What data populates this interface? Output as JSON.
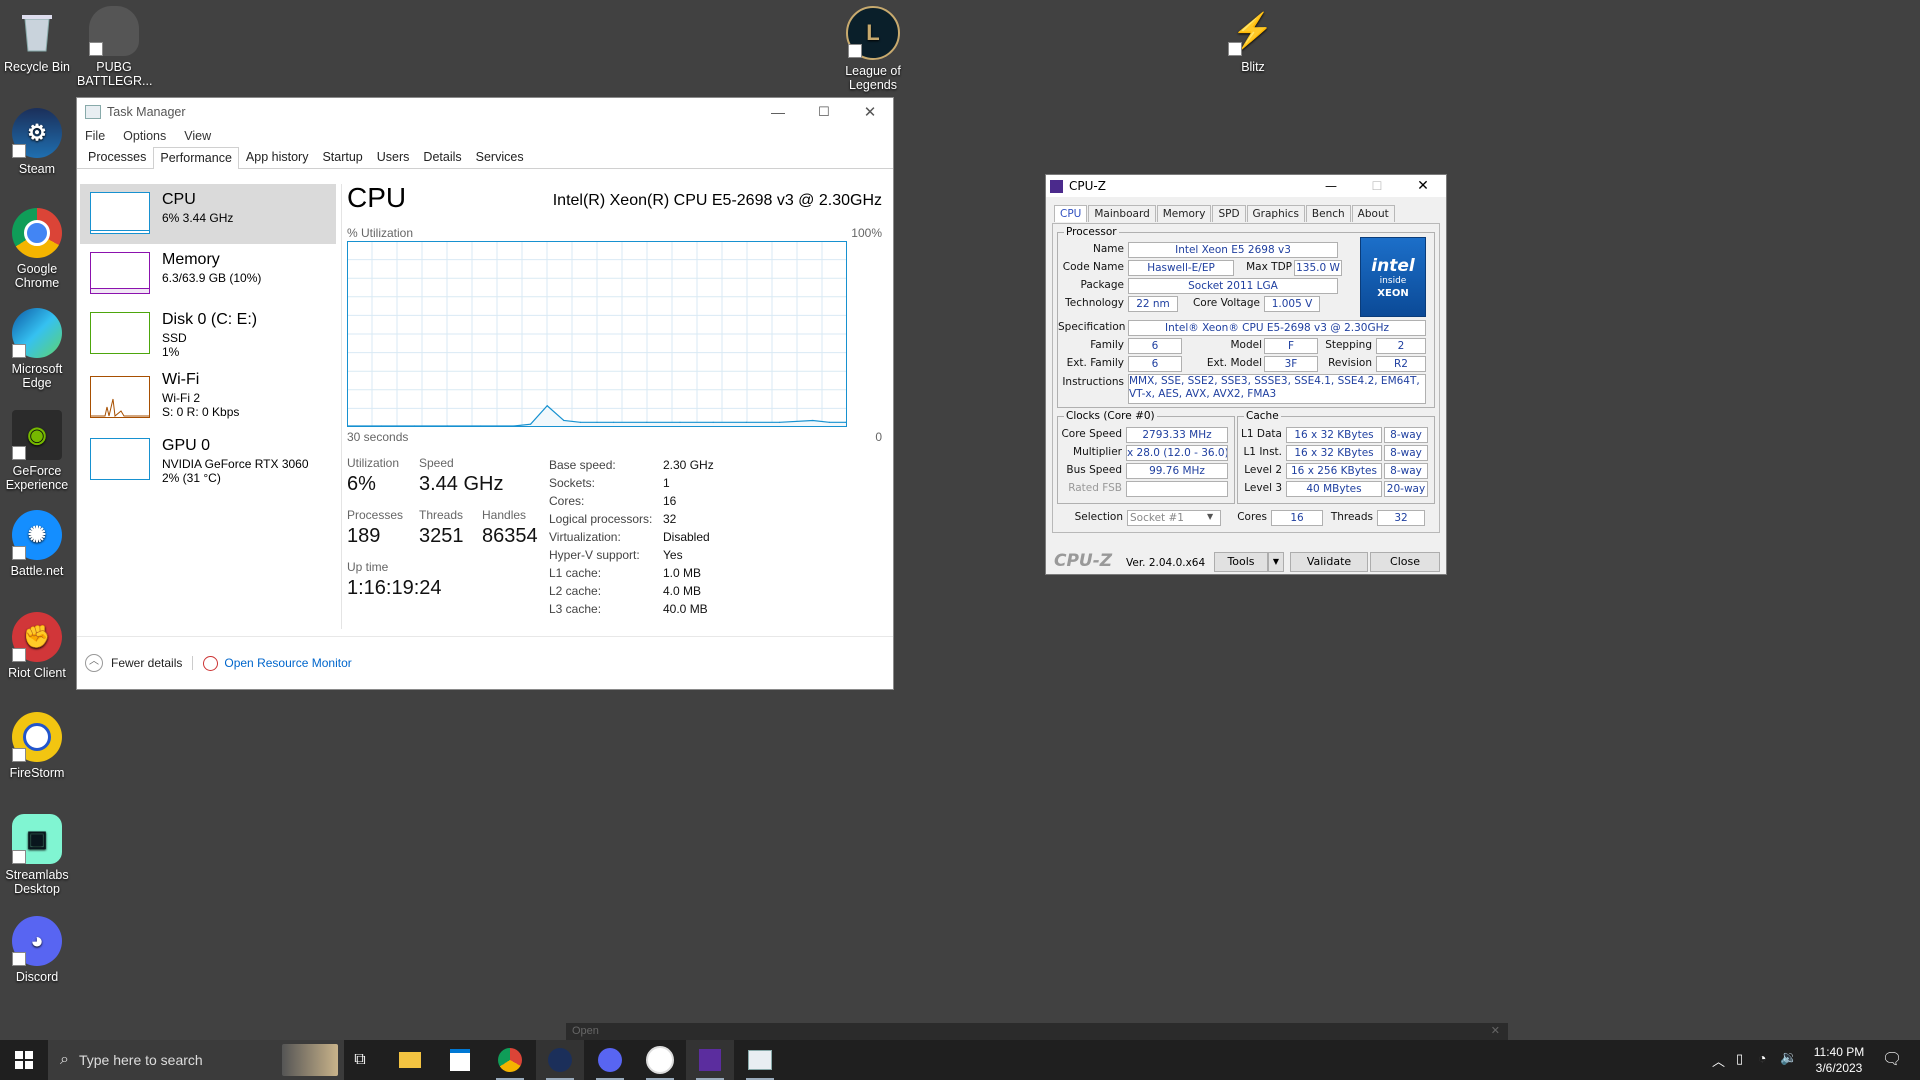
{
  "desktop": {
    "icons": [
      {
        "label": "Recycle Bin"
      },
      {
        "label": "PUBG BATTLEGR..."
      },
      {
        "label": "Steam"
      },
      {
        "label": "Google Chrome"
      },
      {
        "label": "Microsoft Edge"
      },
      {
        "label": "GeForce Experience"
      },
      {
        "label": "Battle.net"
      },
      {
        "label": "Riot Client"
      },
      {
        "label": "FireStorm"
      },
      {
        "label": "Streamlabs Desktop"
      },
      {
        "label": "Discord"
      },
      {
        "label": "League of Legends"
      },
      {
        "label": "Blitz"
      }
    ]
  },
  "taskmanager": {
    "title": "Task Manager",
    "menu": [
      "File",
      "Options",
      "View"
    ],
    "tabs": [
      "Processes",
      "Performance",
      "App history",
      "Startup",
      "Users",
      "Details",
      "Services"
    ],
    "sidebar": [
      {
        "title": "CPU",
        "sub1": "6% 3.44 GHz",
        "sub2": "",
        "sub3": ""
      },
      {
        "title": "Memory",
        "sub1": "6.3/63.9 GB (10%)",
        "sub2": "",
        "sub3": ""
      },
      {
        "title": "Disk 0 (C: E:)",
        "sub1": "SSD",
        "sub2": "1%",
        "sub3": ""
      },
      {
        "title": "Wi-Fi",
        "sub1": "Wi-Fi 2",
        "sub2": "S: 0 R: 0 Kbps",
        "sub3": ""
      },
      {
        "title": "GPU 0",
        "sub1": "NVIDIA GeForce RTX 3060",
        "sub2": "2% (31 °C)",
        "sub3": ""
      }
    ],
    "main": {
      "heading": "CPU",
      "cpu_name": "Intel(R) Xeon(R) CPU E5-2698 v3 @ 2.30GHz",
      "util_label": "% Utilization",
      "util_max": "100%",
      "time_label": "30 seconds",
      "time_end": "0",
      "stats": {
        "utilization_label": "Utilization",
        "utilization": "6%",
        "speed_label": "Speed",
        "speed": "3.44 GHz",
        "processes_label": "Processes",
        "processes": "189",
        "threads_label": "Threads",
        "threads": "3251",
        "handles_label": "Handles",
        "handles": "86354",
        "uptime_label": "Up time",
        "uptime": "1:16:19:24"
      },
      "details": [
        {
          "k": "Base speed:",
          "v": "2.30 GHz"
        },
        {
          "k": "Sockets:",
          "v": "1"
        },
        {
          "k": "Cores:",
          "v": "16"
        },
        {
          "k": "Logical processors:",
          "v": "32"
        },
        {
          "k": "Virtualization:",
          "v": "Disabled"
        },
        {
          "k": "Hyper-V support:",
          "v": "Yes"
        },
        {
          "k": "L1 cache:",
          "v": "1.0 MB"
        },
        {
          "k": "L2 cache:",
          "v": "4.0 MB"
        },
        {
          "k": "L3 cache:",
          "v": "40.0 MB"
        }
      ]
    },
    "footer": {
      "fewer": "Fewer details",
      "monitor": "Open Resource Monitor"
    },
    "chart_data": {
      "type": "line",
      "x": [
        0,
        2,
        4,
        6,
        8,
        10,
        11,
        12,
        13,
        14,
        15,
        16,
        18,
        20,
        22,
        24,
        26,
        28,
        29,
        30
      ],
      "values": [
        0,
        0,
        0,
        0,
        0,
        0,
        1,
        11,
        3,
        2,
        2,
        2,
        2,
        2,
        2,
        2,
        2,
        3,
        2,
        2
      ],
      "ylim": [
        0,
        100
      ],
      "xlim": [
        0,
        30
      ]
    }
  },
  "cpuz": {
    "title": "CPU-Z",
    "tabs": [
      "CPU",
      "Mainboard",
      "Memory",
      "SPD",
      "Graphics",
      "Bench",
      "About"
    ],
    "processor_label": "Processor",
    "name_k": "Name",
    "name": "Intel Xeon E5 2698 v3",
    "codename_k": "Code Name",
    "codename": "Haswell-E/EP",
    "maxtdp_k": "Max TDP",
    "maxtdp": "135.0 W",
    "package_k": "Package",
    "package": "Socket 2011 LGA",
    "technology_k": "Technology",
    "technology": "22 nm",
    "corevoltage_k": "Core Voltage",
    "corevoltage": "1.005 V",
    "spec_k": "Specification",
    "spec": "Intel® Xeon® CPU E5-2698 v3 @ 2.30GHz",
    "family_k": "Family",
    "family": "6",
    "model_k": "Model",
    "model": "F",
    "stepping_k": "Stepping",
    "stepping": "2",
    "extfamily_k": "Ext. Family",
    "extfamily": "6",
    "extmodel_k": "Ext. Model",
    "extmodel": "3F",
    "revision_k": "Revision",
    "revision": "R2",
    "instr_k": "Instructions",
    "instr": "MMX, SSE, SSE2, SSE3, SSSE3, SSE4.1, SSE4.2, EM64T, VT-x, AES, AVX, AVX2, FMA3",
    "clocks_label": "Clocks (Core #0)",
    "corespeed_k": "Core Speed",
    "corespeed": "2793.33 MHz",
    "multiplier_k": "Multiplier",
    "multiplier": "x 28.0 (12.0 - 36.0)",
    "busspeed_k": "Bus Speed",
    "busspeed": "99.76 MHz",
    "ratedfsb_k": "Rated FSB",
    "cache_label": "Cache",
    "l1d_k": "L1 Data",
    "l1d": "16 x 32 KBytes",
    "l1d_w": "8-way",
    "l1i_k": "L1 Inst.",
    "l1i": "16 x 32 KBytes",
    "l1i_w": "8-way",
    "l2_k": "Level 2",
    "l2": "16 x 256 KBytes",
    "l2_w": "8-way",
    "l3_k": "Level 3",
    "l3": "40 MBytes",
    "l3_w": "20-way",
    "selection_k": "Selection",
    "selection": "Socket #1",
    "cores_k": "Cores",
    "cores": "16",
    "threads_k": "Threads",
    "threads": "32",
    "brand": "CPU-Z",
    "version": "Ver. 2.04.0.x64",
    "tools": "Tools",
    "validate": "Validate",
    "close": "Close",
    "intel_logo": {
      "word": "intel",
      "inside": "inside",
      "xeon": "XEON"
    }
  },
  "taskbar": {
    "search_placeholder": "Type here to search",
    "time": "11:40 PM",
    "date": "3/6/2023",
    "open_strip": "Open"
  }
}
